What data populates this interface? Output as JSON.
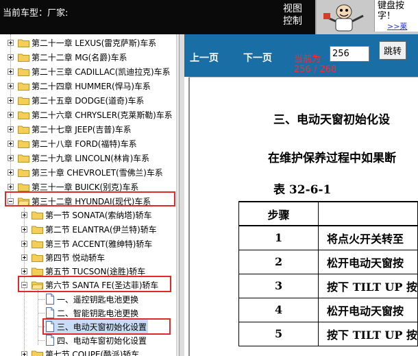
{
  "header": {
    "current_car": "当前车型：厂家:",
    "view_control_line1": "视图",
    "view_control_line2": "控制",
    "ad_line1": "键盘按",
    "ad_line2": "字！",
    "ad_link": ">>莱"
  },
  "tree": {
    "items": [
      {
        "label": "第二十一章 LEXUS(雷克萨斯)车系"
      },
      {
        "label": "第二十二章 MG(名爵)车系"
      },
      {
        "label": "第二十三章 CADILLAC(凯迪拉克)车系"
      },
      {
        "label": "第二十四章 HUMMER(悍马)车系"
      },
      {
        "label": "第二十五章 DODGE(道奇)车系"
      },
      {
        "label": "第二十六章 CHRYSLER(克莱斯勒)车系"
      },
      {
        "label": "第二十七章 JEEP(吉普)车系"
      },
      {
        "label": "第二十八章 FORD(福特)车系"
      },
      {
        "label": "第二十九章 LINCOLN(林肯)车系"
      },
      {
        "label": "第三十章 CHEVROLET(雪佛兰)车系"
      },
      {
        "label": "第三十一章 BUICK(别克)车系"
      },
      {
        "label": "第三十二章 HYUNDAI(现代)车系"
      },
      {
        "label": "第一节 SONATA(索纳塔)轿车"
      },
      {
        "label": "第二节 ELANTRA(伊兰特)轿车"
      },
      {
        "label": "第三节 ACCENT(雅绅特)轿车"
      },
      {
        "label": "第四节 悦动轿车"
      },
      {
        "label": "第五节 TUCSON(途胜)轿车"
      },
      {
        "label": "第六节 SANTA FE(圣达菲)轿车"
      },
      {
        "label": "一、遥控钥匙电池更换"
      },
      {
        "label": "二、智能钥匙电池更换"
      },
      {
        "label": "三、电动天窗初始化设置"
      },
      {
        "label": "四、电动车窗初始化设置"
      },
      {
        "label": "第七节 COUPE(酷派)轿车"
      }
    ]
  },
  "nav": {
    "prev": "上一页",
    "next": "下一页",
    "current_label": "当前为",
    "page_input": "256",
    "go_button": "跳转",
    "page_info": "256 / 268"
  },
  "doc": {
    "heading": "三、电动天窗初始化设",
    "paragraph": "在维护保养过程中如果断",
    "table_caption": "表 32-6-1",
    "table_header": "步骤",
    "rows": [
      {
        "step": "1",
        "text": "将点火开关转至"
      },
      {
        "step": "2",
        "text": "松开电动天窗按"
      },
      {
        "step": "3",
        "text": "按下 TILT UP 按"
      },
      {
        "step": "4",
        "text": "松开电动天窗按"
      },
      {
        "step": "5",
        "text": "按下 TILT UP 按"
      }
    ]
  }
}
